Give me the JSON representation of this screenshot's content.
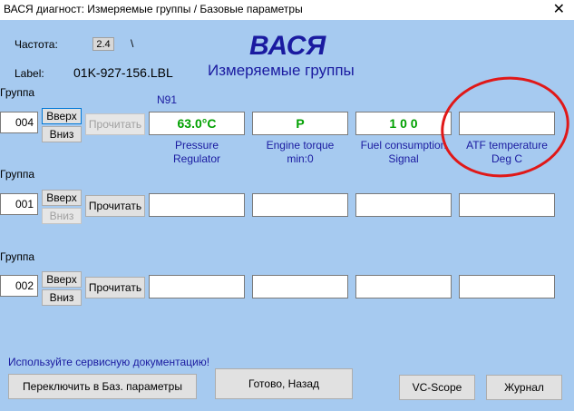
{
  "window": {
    "title": "ВАСЯ диагност: Измеряемые группы / Базовые параметры"
  },
  "header": {
    "freq_label": "Частота:",
    "freq_value": "2.4",
    "freq_spinner": "\\",
    "label_label": "Label:",
    "label_value": "01K-927-156.LBL",
    "app_name": "ВАСЯ",
    "subtitle": "Измеряемые группы"
  },
  "groups": [
    {
      "label": "Группа",
      "number": "004",
      "up_label": "Вверх",
      "down_label": "Вниз",
      "read_label": "Прочитать",
      "extra_label": "N91",
      "values": [
        "63.0°C",
        "P",
        "1 0 0",
        ""
      ],
      "captions": [
        [
          "Pressure",
          "Regulator"
        ],
        [
          "Engine torque",
          "min:0"
        ],
        [
          "Fuel consumption",
          "Signal"
        ],
        [
          "ATF temperature",
          "Deg C"
        ]
      ]
    },
    {
      "label": "Группа",
      "number": "001",
      "up_label": "Вверх",
      "down_label": "Вниз",
      "read_label": "Прочитать",
      "values": [
        "",
        "",
        "",
        ""
      ]
    },
    {
      "label": "Группа",
      "number": "002",
      "up_label": "Вверх",
      "down_label": "Вниз",
      "read_label": "Прочитать",
      "values": [
        "",
        "",
        "",
        ""
      ]
    }
  ],
  "footer": {
    "hint": "Используйте сервисную документацию!",
    "switch_label": "Переключить в Баз. параметры",
    "done_label": "Готово, Назад",
    "vcscope_label": "VC-Scope",
    "journal_label": "Журнал"
  },
  "colors": {
    "background": "#a6caf0",
    "value_green": "#00a000",
    "caption_blue": "#1a1aa0",
    "annotation_red": "#e01818"
  }
}
